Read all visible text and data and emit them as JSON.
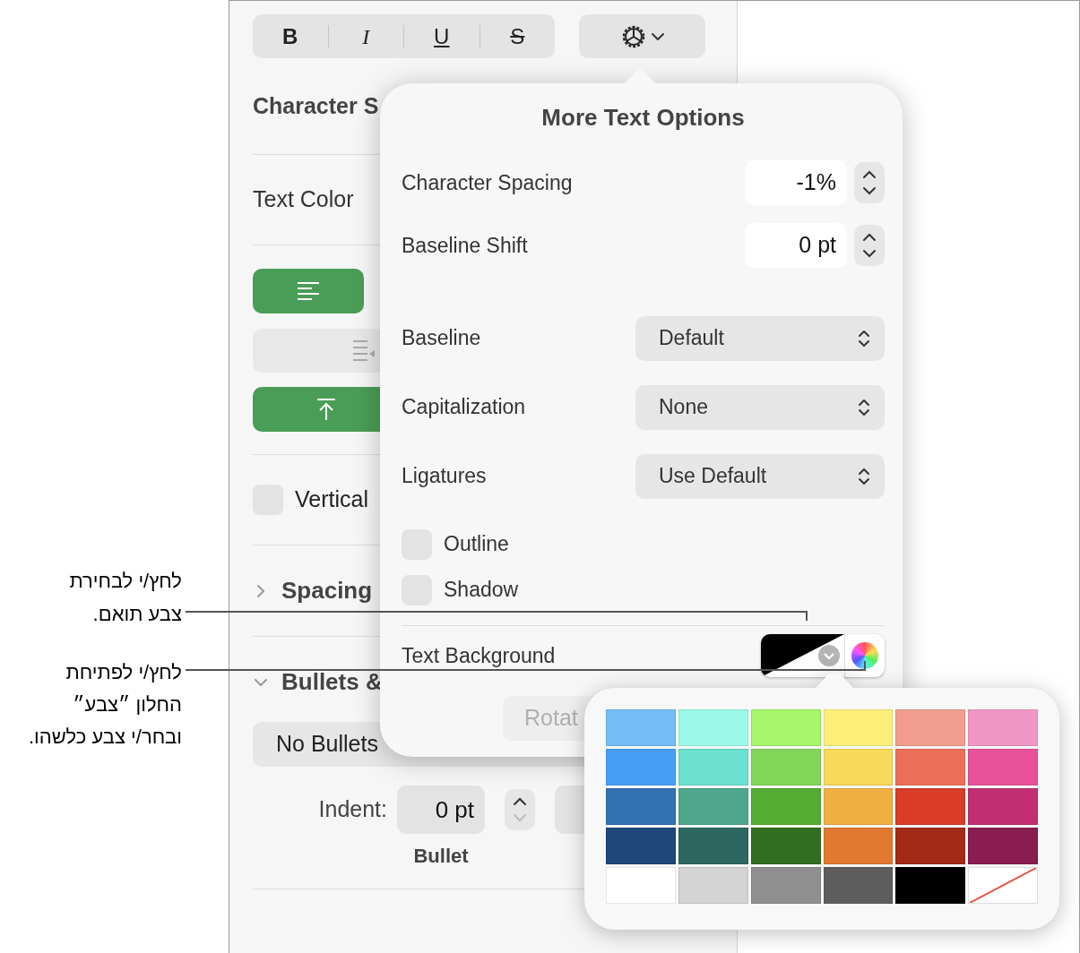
{
  "toolbar": {
    "style_buttons": [
      {
        "label": "B",
        "selected": false
      },
      {
        "label": "I",
        "selected": false
      },
      {
        "label": "U",
        "selected": false
      },
      {
        "label": "S",
        "selected": false
      }
    ]
  },
  "sidebar": {
    "character_styles_label": "Character S",
    "text_color_label": "Text Color",
    "horizontal_alignment": {
      "selected": true
    },
    "vertical_alignment": {
      "selected": true
    },
    "vertical_text": {
      "label": "Vertical",
      "checked": false
    },
    "sections": [
      {
        "title": "Spacing",
        "expanded": false
      },
      {
        "title": "Bullets &",
        "expanded": true
      }
    ],
    "bullets_popup": "No Bullets",
    "indent": {
      "label": "Indent:",
      "value": "0 pt",
      "caption": "Bullet"
    },
    "rotate_button": "Rotat"
  },
  "more_text_options": {
    "title": "More Text Options",
    "steppers": [
      {
        "label": "Character Spacing",
        "value": "-1%"
      },
      {
        "label": "Baseline Shift",
        "value": "0 pt"
      }
    ],
    "popups": [
      {
        "label": "Baseline",
        "value": "Default"
      },
      {
        "label": "Capitalization",
        "value": "None"
      },
      {
        "label": "Ligatures",
        "value": "Use Default"
      }
    ],
    "checkboxes": [
      {
        "label": "Outline",
        "checked": false
      },
      {
        "label": "Shadow",
        "checked": false
      }
    ],
    "text_background": {
      "label": "Text Background"
    }
  },
  "swatches": [
    {
      "kind": "color",
      "color": "#72bdf8"
    },
    {
      "kind": "color",
      "color": "#9cf9e8"
    },
    {
      "kind": "color",
      "color": "#a6f66c"
    },
    {
      "kind": "color",
      "color": "#fdf07a"
    },
    {
      "kind": "color",
      "color": "#f19c8f"
    },
    {
      "kind": "color",
      "color": "#f197c6"
    },
    {
      "kind": "color",
      "color": "#469ef6"
    },
    {
      "kind": "color",
      "color": "#6de1d0"
    },
    {
      "kind": "color",
      "color": "#84d65a"
    },
    {
      "kind": "color",
      "color": "#f8d95a"
    },
    {
      "kind": "color",
      "color": "#eb6f58"
    },
    {
      "kind": "color",
      "color": "#e9529a"
    },
    {
      "kind": "color",
      "color": "#3271b3"
    },
    {
      "kind": "color",
      "color": "#4ea78d"
    },
    {
      "kind": "color",
      "color": "#55ad33"
    },
    {
      "kind": "color",
      "color": "#f0af41"
    },
    {
      "kind": "color",
      "color": "#d93c27"
    },
    {
      "kind": "color",
      "color": "#c12f72"
    },
    {
      "kind": "color",
      "color": "#1e4879"
    },
    {
      "kind": "color",
      "color": "#2c6760"
    },
    {
      "kind": "color",
      "color": "#316e22"
    },
    {
      "kind": "color",
      "color": "#e17931"
    },
    {
      "kind": "color",
      "color": "#a22a17"
    },
    {
      "kind": "color",
      "color": "#891d4f"
    },
    {
      "kind": "color",
      "color": "#ffffff"
    },
    {
      "kind": "color",
      "color": "#d4d4d4"
    },
    {
      "kind": "color",
      "color": "#8f8f8f"
    },
    {
      "kind": "color",
      "color": "#5d5d5d"
    },
    {
      "kind": "color",
      "color": "#000000"
    },
    {
      "kind": "none"
    }
  ],
  "callouts": [
    {
      "lines": [
        "לחץ/י לבחירת",
        "צבע תואם."
      ]
    },
    {
      "lines": [
        "לחץ/י לפתיחת",
        "החלון ״צבע״",
        "ובחר/י צבע כלשהו."
      ]
    }
  ]
}
